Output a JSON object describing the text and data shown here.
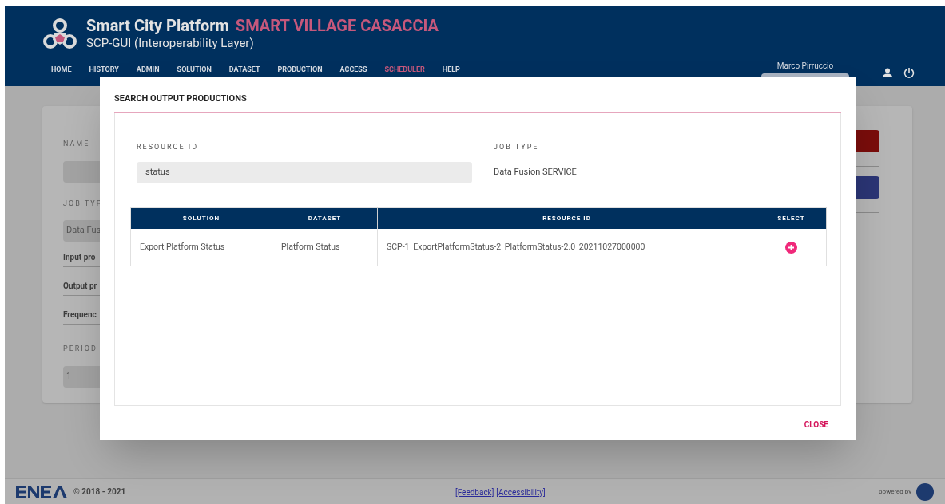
{
  "header": {
    "title": "Smart City Platform",
    "site": "SMART VILLAGE CASACCIA",
    "subtitle": "SCP-GUI (Interoperability Layer)",
    "user": "Marco Pirruccio"
  },
  "nav": [
    {
      "label": "HOME",
      "selected": false
    },
    {
      "label": "HISTORY",
      "selected": false
    },
    {
      "label": "ADMIN",
      "selected": false
    },
    {
      "label": "SOLUTION",
      "selected": false
    },
    {
      "label": "DATASET",
      "selected": false
    },
    {
      "label": "PRODUCTION",
      "selected": false
    },
    {
      "label": "ACCESS",
      "selected": false
    },
    {
      "label": "SCHEDULER",
      "selected": true
    },
    {
      "label": "HELP",
      "selected": false
    }
  ],
  "background_form": [
    {
      "kind": "label",
      "text": "NAME"
    },
    {
      "kind": "field"
    },
    {
      "kind": "label",
      "text": "JOB TYP"
    },
    {
      "kind": "field",
      "text": "Data Fus"
    },
    {
      "kind": "heading",
      "text": "Input pro"
    },
    {
      "kind": "heading",
      "text": "Output pr"
    },
    {
      "kind": "heading",
      "text": "Frequenc"
    },
    {
      "kind": "label",
      "text": "PERIOD"
    },
    {
      "kind": "field",
      "text": "1"
    }
  ],
  "dialog": {
    "title": "SEARCH OUTPUT PRODUCTIONS",
    "resource_id": {
      "label": "RESOURCE ID",
      "value": "status"
    },
    "job_type": {
      "label": "JOB TYPE",
      "value": "Data Fusion SERVICE"
    },
    "table": {
      "columns": [
        "SOLUTION",
        "DATASET",
        "RESOURCE ID",
        "SELECT"
      ],
      "rows": [
        {
          "solution": "Export Platform Status",
          "dataset": "Platform Status",
          "resource_id": "SCP-1_ExportPlatformStatus-2_PlatformStatus-2.0_20211027000000"
        }
      ]
    },
    "close": "CLOSE"
  },
  "footer": {
    "copyright": "© 2018 - 2021",
    "links": [
      "[Feedback]",
      "[Accessibility]"
    ],
    "powered_by": "powered by"
  }
}
